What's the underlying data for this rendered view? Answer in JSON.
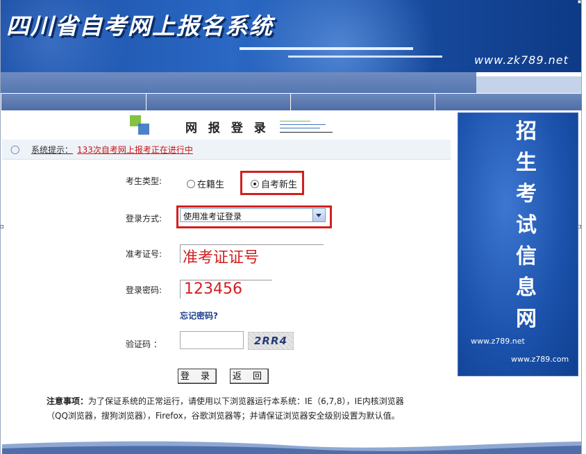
{
  "banner": {
    "title": "四川省自考网上报名系统",
    "url": "www.zk789.net"
  },
  "login": {
    "heading": "网 报 登 录"
  },
  "notice": {
    "label": "系统提示：",
    "text": "133次自考网上报考正在进行中"
  },
  "form": {
    "candidate_type_label": "考生类型:",
    "candidate_type_options": [
      "在籍生",
      "自考新生"
    ],
    "candidate_type_selected": "自考新生",
    "login_method_label": "登录方式:",
    "login_method_value": "使用准考证登录",
    "ticket_label": "准考证号:",
    "ticket_hint": "准考证证号",
    "password_label": "登录密码:",
    "password_hint": "123456",
    "forgot_link": "忘记密码?",
    "captcha_label": "验证码 ：",
    "captcha_text": "2RR4",
    "login_button": "登 录",
    "back_button": "返 回"
  },
  "notes": {
    "title": "注意事项：",
    "text": "为了保证系统的正常运行，请使用以下浏览器运行本系统：IE（6,7,8），IE内核浏览器（QQ浏览器，搜狗浏览器），Firefox，谷歌浏览器等；并请保证浏览器安全级别设置为默认值。"
  },
  "side_panel": {
    "chars": [
      "招",
      "生",
      "考",
      "试",
      "信",
      "息",
      "网"
    ],
    "url1": "www.z789.net",
    "url2": "www.z789.com"
  },
  "colors": {
    "banner_blue": "#1b4fa5",
    "highlight_red": "#d01f1f",
    "notice_red": "#c81616",
    "link_blue": "#1a3f8f"
  }
}
